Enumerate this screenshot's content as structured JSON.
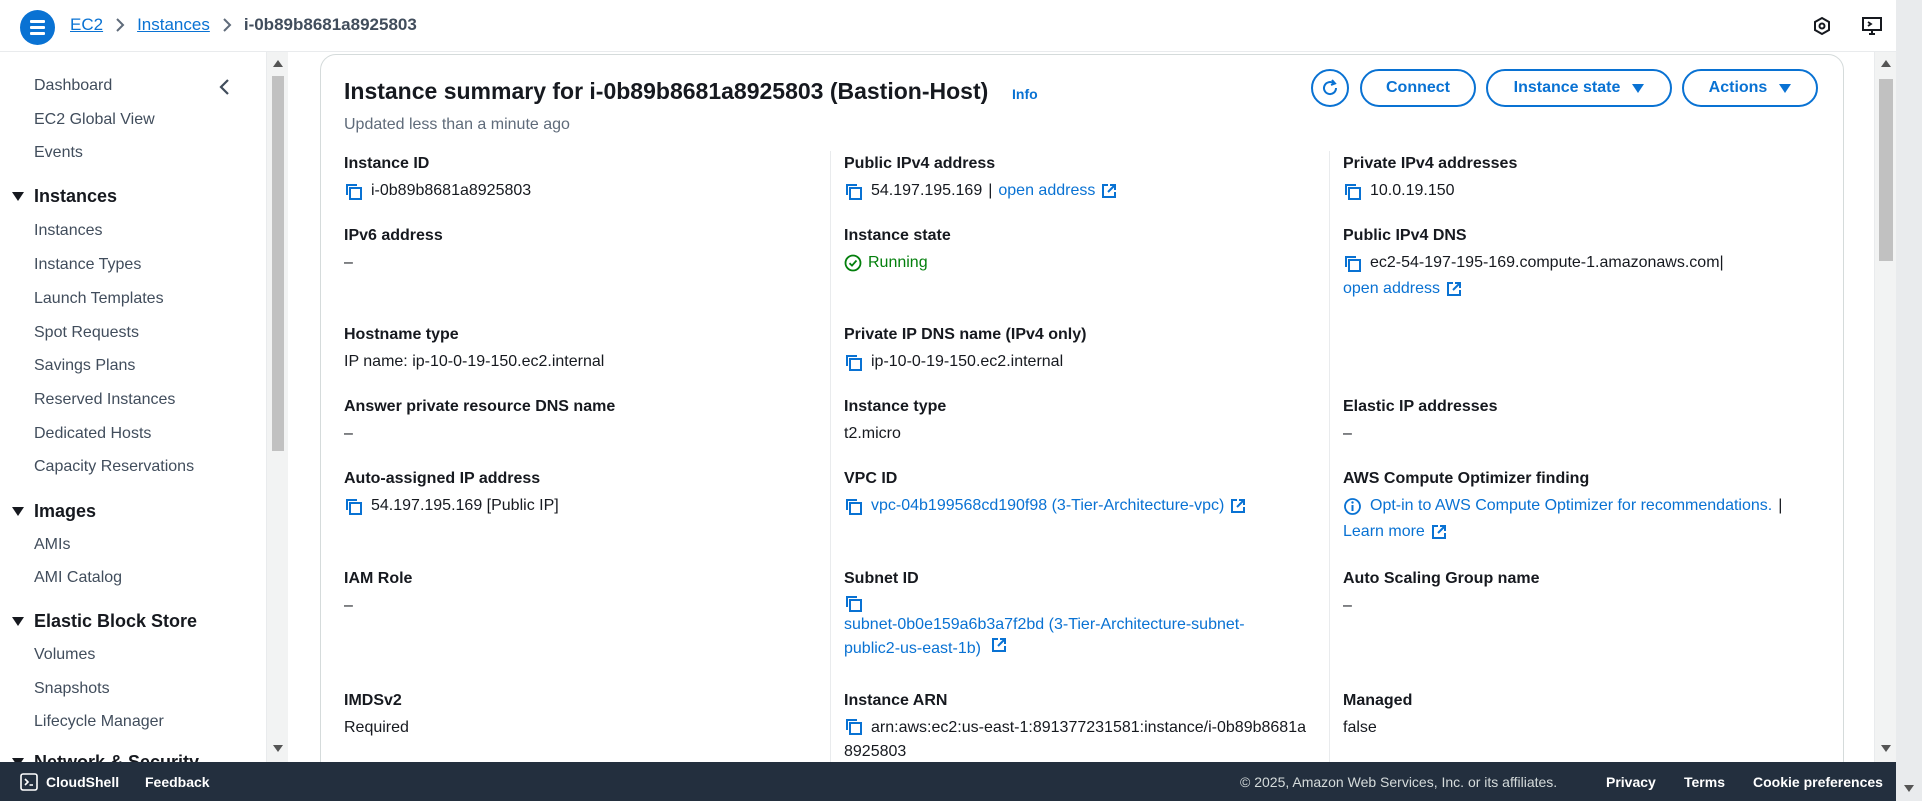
{
  "breadcrumb": {
    "ec2": "EC2",
    "instances": "Instances",
    "current": "i-0b89b8681a8925803"
  },
  "top_icons": [
    "settings-hexagon-icon",
    "display-icon"
  ],
  "sidebar": {
    "items_top": [
      "Dashboard",
      "EC2 Global View",
      "Events"
    ],
    "groups": [
      {
        "label": "Instances",
        "items": [
          "Instances",
          "Instance Types",
          "Launch Templates",
          "Spot Requests",
          "Savings Plans",
          "Reserved Instances",
          "Dedicated Hosts",
          "Capacity Reservations"
        ]
      },
      {
        "label": "Images",
        "items": [
          "AMIs",
          "AMI Catalog"
        ]
      },
      {
        "label": "Elastic Block Store",
        "items": [
          "Volumes",
          "Snapshots",
          "Lifecycle Manager"
        ]
      },
      {
        "label": "Network & Security",
        "items": []
      }
    ]
  },
  "summary": {
    "title": "Instance summary for i-0b89b8681a8925803 (Bastion-Host)",
    "info": "Info",
    "updated": "Updated less than a minute ago",
    "buttons": {
      "connect": "Connect",
      "instance_state": "Instance state",
      "actions": "Actions"
    }
  },
  "fields": {
    "instance_id": {
      "label": "Instance ID",
      "value": "i-0b89b8681a8925803"
    },
    "public_ipv4": {
      "label": "Public IPv4 address",
      "value": "54.197.195.169",
      "link": "open address"
    },
    "private_ipv4": {
      "label": "Private IPv4 addresses",
      "value": "10.0.19.150"
    },
    "ipv6": {
      "label": "IPv6 address",
      "value": "–"
    },
    "instance_state": {
      "label": "Instance state",
      "value": "Running"
    },
    "public_dns": {
      "label": "Public IPv4 DNS",
      "value": "ec2-54-197-195-169.compute-1.amazonaws.com",
      "link": "open address"
    },
    "hostname_type": {
      "label": "Hostname type",
      "value": "IP name: ip-10-0-19-150.ec2.internal"
    },
    "private_dns": {
      "label": "Private IP DNS name (IPv4 only)",
      "value": "ip-10-0-19-150.ec2.internal"
    },
    "answer_dns": {
      "label": "Answer private resource DNS name",
      "value": "–"
    },
    "instance_type": {
      "label": "Instance type",
      "value": "t2.micro"
    },
    "elastic_ip": {
      "label": "Elastic IP addresses",
      "value": "–"
    },
    "auto_ip": {
      "label": "Auto-assigned IP address",
      "value": "54.197.195.169 [Public IP]"
    },
    "vpc_id": {
      "label": "VPC ID",
      "value": "vpc-04b199568cd190f98 (3-Tier-Architecture-vpc)"
    },
    "optimizer": {
      "label": "AWS Compute Optimizer finding",
      "value": "Opt-in to AWS Compute Optimizer for recommendations.",
      "link": "Learn more"
    },
    "iam_role": {
      "label": "IAM Role",
      "value": "–"
    },
    "subnet_id": {
      "label": "Subnet ID",
      "value": "subnet-0b0e159a6b3a7f2bd (3-Tier-Architecture-subnet-public2-us-east-1b)"
    },
    "asg": {
      "label": "Auto Scaling Group name",
      "value": "–"
    },
    "imdsv2": {
      "label": "IMDSv2",
      "value": "Required"
    },
    "arn": {
      "label": "Instance ARN",
      "value": "arn:aws:ec2:us-east-1:891377231581:instance/i-0b89b8681a8925803"
    },
    "managed": {
      "label": "Managed",
      "value": "false"
    }
  },
  "footer": {
    "cloudshell": "CloudShell",
    "feedback": "Feedback",
    "copyright": "© 2025, Amazon Web Services, Inc. or its affiliates.",
    "privacy": "Privacy",
    "terms": "Terms",
    "cookies": "Cookie preferences"
  },
  "colors": {
    "accent": "#0972d3",
    "running": "#037f0c",
    "footer_bg": "#232f3e"
  }
}
